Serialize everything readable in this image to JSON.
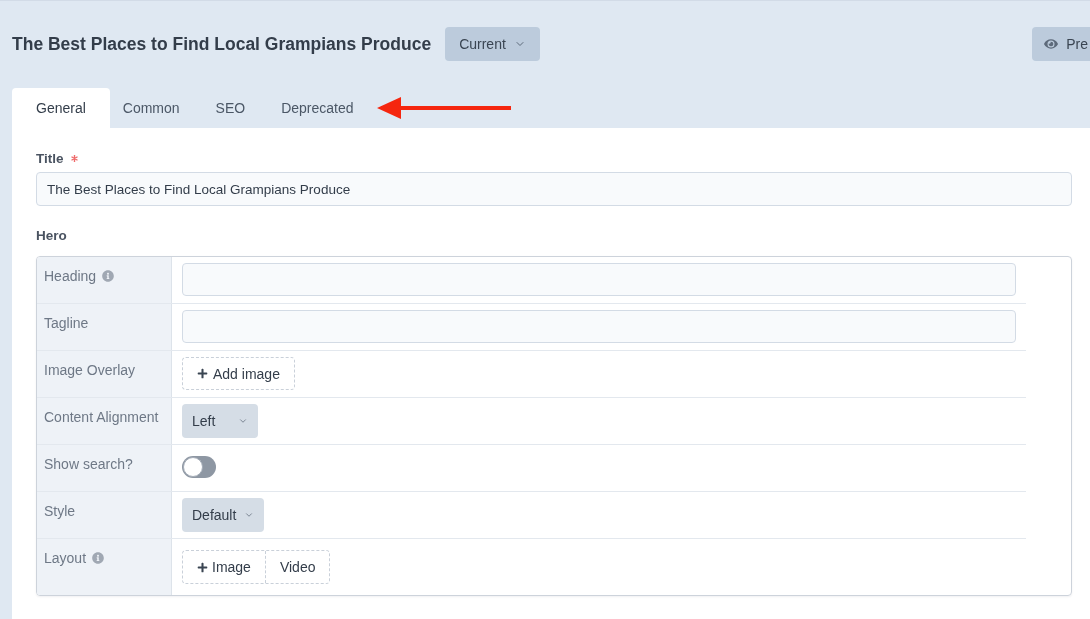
{
  "header": {
    "title": "The Best Places to Find Local Grampians Produce",
    "version_button": {
      "label": "Current"
    },
    "preview_button": {
      "label": "Pre"
    }
  },
  "tabs": [
    {
      "label": "General",
      "selected": true
    },
    {
      "label": "Common",
      "selected": false
    },
    {
      "label": "SEO",
      "selected": false
    },
    {
      "label": "Deprecated",
      "selected": false
    }
  ],
  "form": {
    "title_field": {
      "label": "Title",
      "required": true,
      "value": "The Best Places to Find Local Grampians Produce"
    },
    "hero": {
      "label": "Hero",
      "rows": [
        {
          "label": "Heading",
          "info": true,
          "kind": "text"
        },
        {
          "label": "Tagline",
          "info": false,
          "kind": "text"
        },
        {
          "label": "Image Overlay",
          "info": false,
          "kind": "image",
          "button": "Add image"
        },
        {
          "label": "Content Alignment",
          "info": false,
          "kind": "select",
          "value": "Left"
        },
        {
          "label": "Show search?",
          "info": false,
          "kind": "toggle",
          "on": false
        },
        {
          "label": "Style",
          "info": false,
          "kind": "select",
          "value": "Default"
        },
        {
          "label": "Layout",
          "info": true,
          "kind": "choice",
          "options": [
            {
              "label": "Image",
              "add": true
            },
            {
              "label": "Video",
              "add": false
            }
          ]
        }
      ]
    }
  }
}
